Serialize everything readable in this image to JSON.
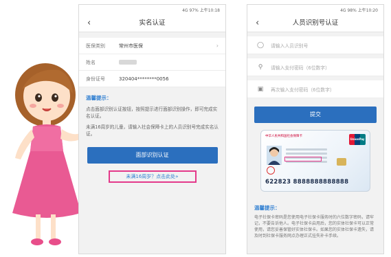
{
  "left_phone": {
    "status": "4G 97% 上午10:18",
    "title": "实名认证",
    "back": "‹",
    "rows": [
      {
        "key": "医保类别",
        "value": "常州市医保"
      },
      {
        "key": "姓名",
        "value": ""
      },
      {
        "key": "身份证号",
        "value": "320404********0056"
      }
    ],
    "tips_title": "温馨提示：",
    "tips": [
      "点击面部识别认证按钮，按照提示进行面部识别操作，即可完成实名认证。",
      "未满16周岁的儿童，请输入社会保障卡上的人员识别号完成实名认证。"
    ],
    "face_button": "面部识别认证",
    "under16_link": "未满16周岁？点击此处»"
  },
  "right_phone": {
    "status": "4G 98% 上午10:20",
    "title": "人员识别号认证",
    "back": "‹",
    "fields": [
      {
        "placeholder": "请输入人员识别号",
        "icon": "user-icon"
      },
      {
        "placeholder": "请输入支付密码（6位数字）",
        "icon": "key-icon"
      },
      {
        "placeholder": "再次输入支付密码（6位数字）",
        "icon": "lock-icon"
      }
    ],
    "submit": "提交",
    "card": {
      "header": "中华人民共和国社会保障卡",
      "brand": "UnionPay",
      "number": "622823 8888888888888"
    },
    "tips_title": "温馨提示：",
    "tips_text": "电子社保卡密码是您使用电子社保卡服务时的六位数字密码，请牢记，不要告诉他人。电子社保卡启用后，您的实体社保卡可以正常使用，请您妥善保管好实体社保卡。如果您的实体社保卡遗失，请及时到社保卡服务网点办理正式挂失补卡手续。"
  },
  "colors": {
    "primary": "#2b6fbe",
    "highlight": "#e4398a",
    "tip": "#2f7fd1"
  }
}
